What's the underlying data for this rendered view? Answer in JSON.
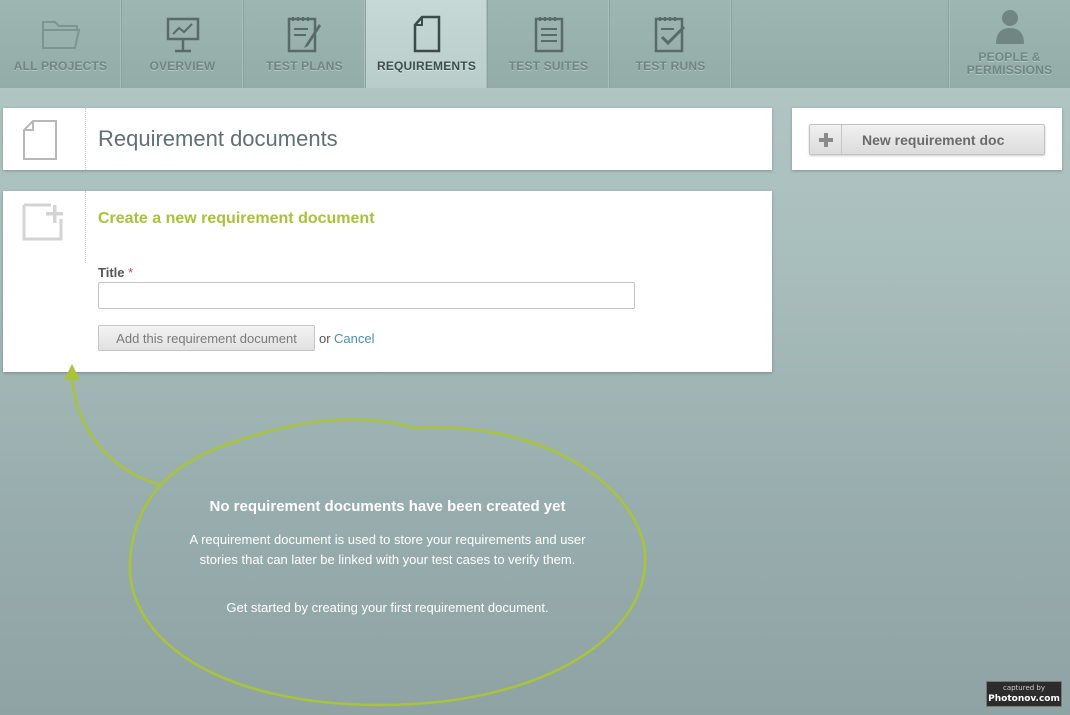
{
  "nav": {
    "items": [
      {
        "label": "ALL PROJECTS",
        "icon": "folder-icon"
      },
      {
        "label": "OVERVIEW",
        "icon": "presentation-board-icon"
      },
      {
        "label": "TEST PLANS",
        "icon": "notepad-pen-icon"
      },
      {
        "label": "REQUIREMENTS",
        "icon": "document-icon",
        "active": true
      },
      {
        "label": "TEST SUITES",
        "icon": "notepad-lines-icon"
      },
      {
        "label": "TEST RUNS",
        "icon": "notepad-check-icon"
      }
    ],
    "people": {
      "label_line1": "PEOPLE &",
      "label_line2": "PERMISSIONS",
      "icon": "person-icon"
    }
  },
  "header": {
    "title": "Requirement documents",
    "icon": "document-icon"
  },
  "sidebar": {
    "new_button_label": "New requirement doc",
    "icon": "plus-icon"
  },
  "form": {
    "heading": "Create a new requirement document",
    "icon": "new-document-icon",
    "title_label": "Title",
    "required_marker": "*",
    "title_value": "",
    "submit_label": "Add this requirement document",
    "or_text": "or",
    "cancel_label": "Cancel"
  },
  "empty_state": {
    "title": "No requirement documents have been created yet",
    "body": "A requirement document is used to store your requirements and user stories that can later be linked with your test cases to verify them.",
    "cta": "Get started by creating your first requirement document."
  },
  "watermark": {
    "line1": "captured by",
    "line2": "Photonov.com"
  },
  "colors": {
    "accent_green": "#a7c33a",
    "link_blue": "#4a8fb8",
    "nav_bg": "#9db6b2",
    "nav_active_bg": "#c6d8d5"
  }
}
